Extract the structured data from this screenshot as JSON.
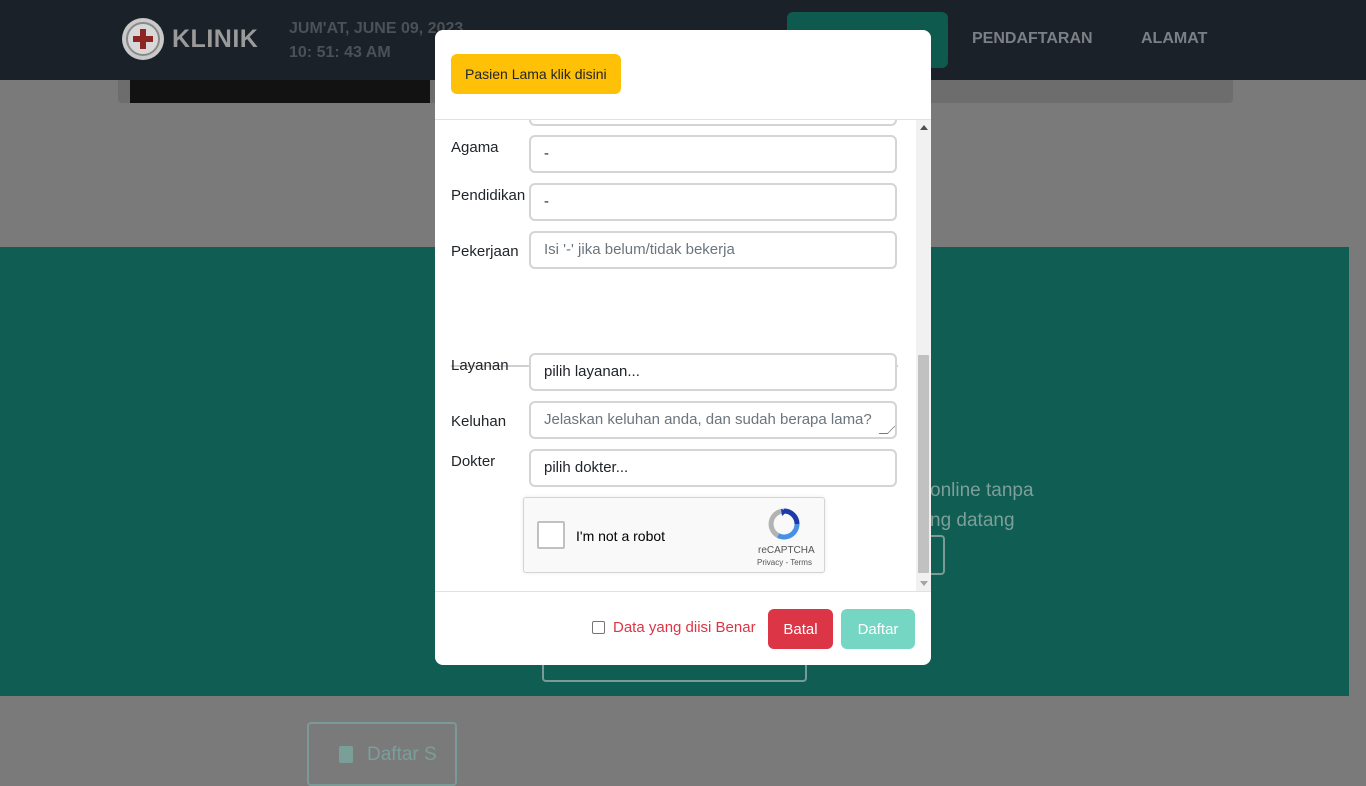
{
  "navbar": {
    "brand": "KLINIK",
    "date": "JUM'AT, JUNE 09, 2023",
    "time": "10: 51: 43 AM",
    "links": [
      "PENDAFTARAN",
      "ALAMAT"
    ]
  },
  "background": {
    "button_label": "Daftar S",
    "text_line1": "online tanpa",
    "text_line2": "ng datang"
  },
  "modal": {
    "old_patient_button": "Pasien Lama klik disini",
    "fields": {
      "agama": {
        "label": "Agama",
        "value": "-"
      },
      "pendidikan": {
        "label": "Pendidikan",
        "value": "-"
      },
      "pekerjaan": {
        "label": "Pekerjaan",
        "placeholder": "Isi '-' jika belum/tidak bekerja"
      },
      "layanan": {
        "label": "Layanan",
        "value": "pilih layanan..."
      },
      "keluhan": {
        "label": "Keluhan",
        "placeholder": "Jelaskan keluhan anda, dan sudah berapa lama?"
      },
      "dokter": {
        "label": "Dokter",
        "value": "pilih dokter..."
      }
    },
    "recaptcha": {
      "label": "I'm not a robot",
      "brand": "reCAPTCHA",
      "links": "Privacy - Terms"
    },
    "footer": {
      "confirm_label": "Data yang diisi Benar",
      "cancel_label": "Batal",
      "submit_label": "Daftar"
    }
  },
  "colors": {
    "navbar": "#1a2129",
    "teal": "#0f5d53",
    "warning": "#ffc107",
    "danger": "#dc3545",
    "submit_disabled": "#75d6c4"
  }
}
